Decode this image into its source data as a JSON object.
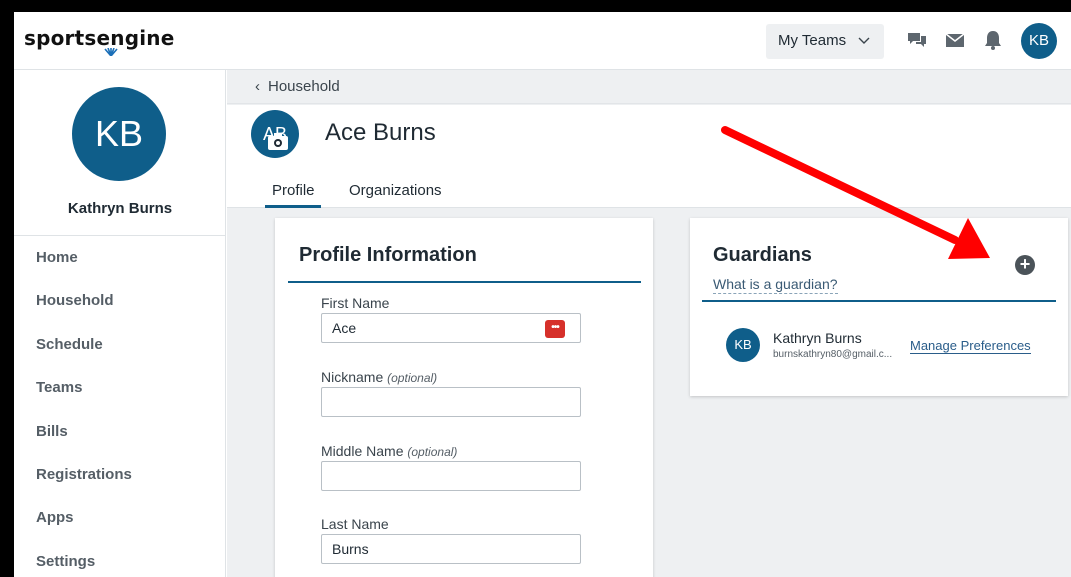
{
  "topbar": {
    "logo_text": "sportsengine",
    "my_teams_label": "My Teams",
    "icons": [
      "chat-icon",
      "mail-icon",
      "bell-icon"
    ],
    "user_initials": "KB"
  },
  "sidebar": {
    "user_initials": "KB",
    "user_name": "Kathryn Burns",
    "items": [
      {
        "label": "Home"
      },
      {
        "label": "Household"
      },
      {
        "label": "Schedule"
      },
      {
        "label": "Teams"
      },
      {
        "label": "Bills"
      },
      {
        "label": "Registrations"
      },
      {
        "label": "Apps"
      },
      {
        "label": "Settings"
      }
    ]
  },
  "breadcrumb": {
    "back_label": "Household"
  },
  "player": {
    "initials": "AB",
    "name": "Ace Burns",
    "tabs": [
      {
        "label": "Profile"
      },
      {
        "label": "Organizations"
      }
    ]
  },
  "profile": {
    "title": "Profile Information",
    "fields": [
      {
        "label": "First Name",
        "optional": "",
        "value": "Ace"
      },
      {
        "label": "Nickname",
        "optional": "(optional)",
        "value": ""
      },
      {
        "label": "Middle Name",
        "optional": "(optional)",
        "value": ""
      },
      {
        "label": "Last Name",
        "optional": "",
        "value": "Burns"
      }
    ],
    "password_badge": "•••"
  },
  "guardians": {
    "title": "Guardians",
    "help_link": "What is a guardian?",
    "add_symbol": "+",
    "list": [
      {
        "initials": "KB",
        "name": "Kathryn Burns",
        "email": "burnskathryn80@gmail.c...",
        "action": "Manage Preferences"
      }
    ]
  },
  "colors": {
    "brand": "#0f5e8a",
    "annotation_arrow": "#ff0000",
    "background": "#eef0f2"
  }
}
